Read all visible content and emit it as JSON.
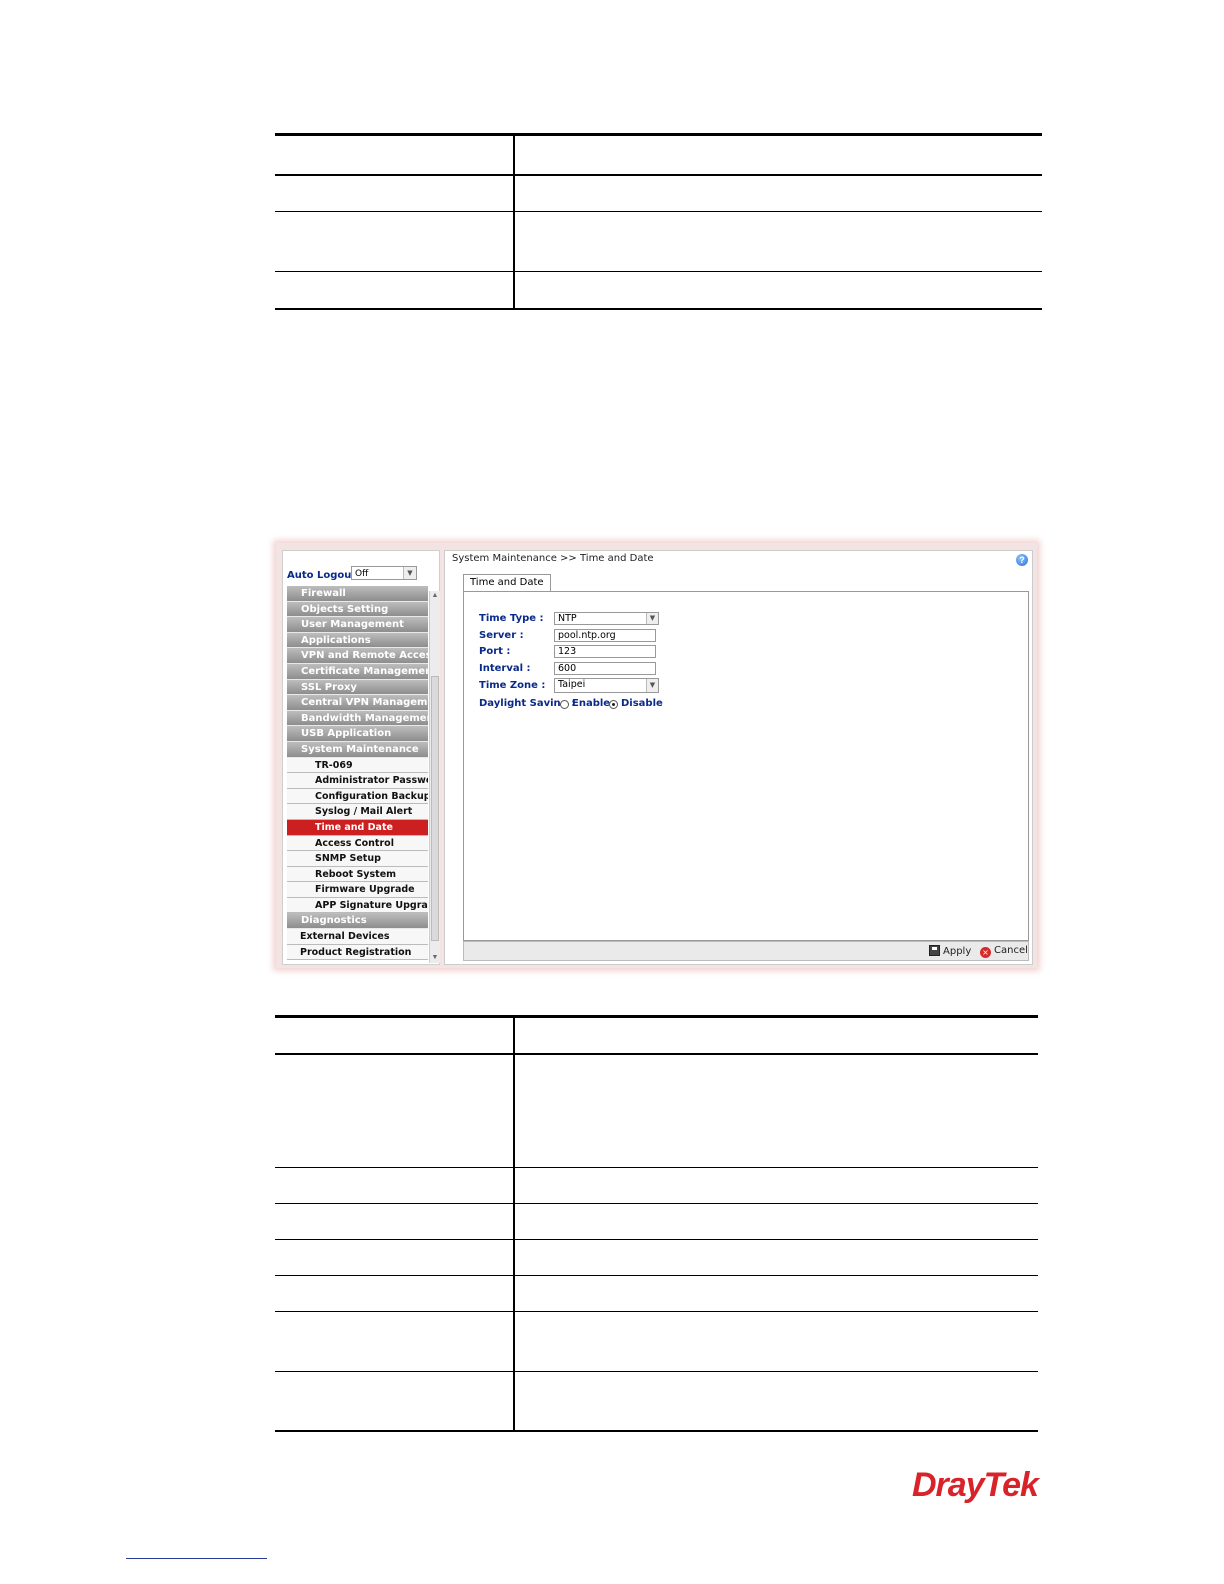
{
  "screenshot": {
    "auto_logout_label": "Auto Logout :",
    "auto_logout_value": "Off",
    "menu": [
      {
        "label": "Firewall",
        "kind": "group"
      },
      {
        "label": "Objects Setting",
        "kind": "group"
      },
      {
        "label": "User Management",
        "kind": "group"
      },
      {
        "label": "Applications",
        "kind": "group"
      },
      {
        "label": "VPN and Remote Access",
        "kind": "group"
      },
      {
        "label": "Certificate Management",
        "kind": "group"
      },
      {
        "label": "SSL Proxy",
        "kind": "group"
      },
      {
        "label": "Central VPN Managem...",
        "kind": "group"
      },
      {
        "label": "Bandwidth Management",
        "kind": "group"
      },
      {
        "label": "USB Application",
        "kind": "group"
      },
      {
        "label": "System Maintenance",
        "kind": "group"
      },
      {
        "label": "TR-069",
        "kind": "sub"
      },
      {
        "label": "Administrator Password",
        "kind": "sub"
      },
      {
        "label": "Configuration Backup",
        "kind": "sub"
      },
      {
        "label": "Syslog / Mail Alert",
        "kind": "sub"
      },
      {
        "label": "Time and Date",
        "kind": "sub-active"
      },
      {
        "label": "Access Control",
        "kind": "sub"
      },
      {
        "label": "SNMP Setup",
        "kind": "sub"
      },
      {
        "label": "Reboot System",
        "kind": "sub"
      },
      {
        "label": "Firmware Upgrade",
        "kind": "sub"
      },
      {
        "label": "APP Signature Upgrade",
        "kind": "sub"
      },
      {
        "label": "Diagnostics",
        "kind": "group"
      },
      {
        "label": "External Devices",
        "kind": "plain"
      },
      {
        "label": "Product Registration",
        "kind": "plain"
      }
    ],
    "breadcrumb": "System Maintenance >> Time and Date",
    "tab_label": "Time and Date",
    "form": {
      "time_type_label": "Time Type :",
      "time_type_value": "NTP",
      "server_label": "Server :",
      "server_value": "pool.ntp.org",
      "port_label": "Port :",
      "port_value": "123",
      "interval_label": "Interval :",
      "interval_value": "600",
      "time_zone_label": "Time Zone :",
      "time_zone_value": "Taipei",
      "daylight_label": "Daylight Saving :",
      "enable_label": "Enable",
      "disable_label": "Disable",
      "daylight_selected": "Disable"
    },
    "apply_label": "Apply",
    "cancel_label": "Cancel"
  },
  "logo": {
    "dray": "Dray",
    "tek": "Tek"
  }
}
